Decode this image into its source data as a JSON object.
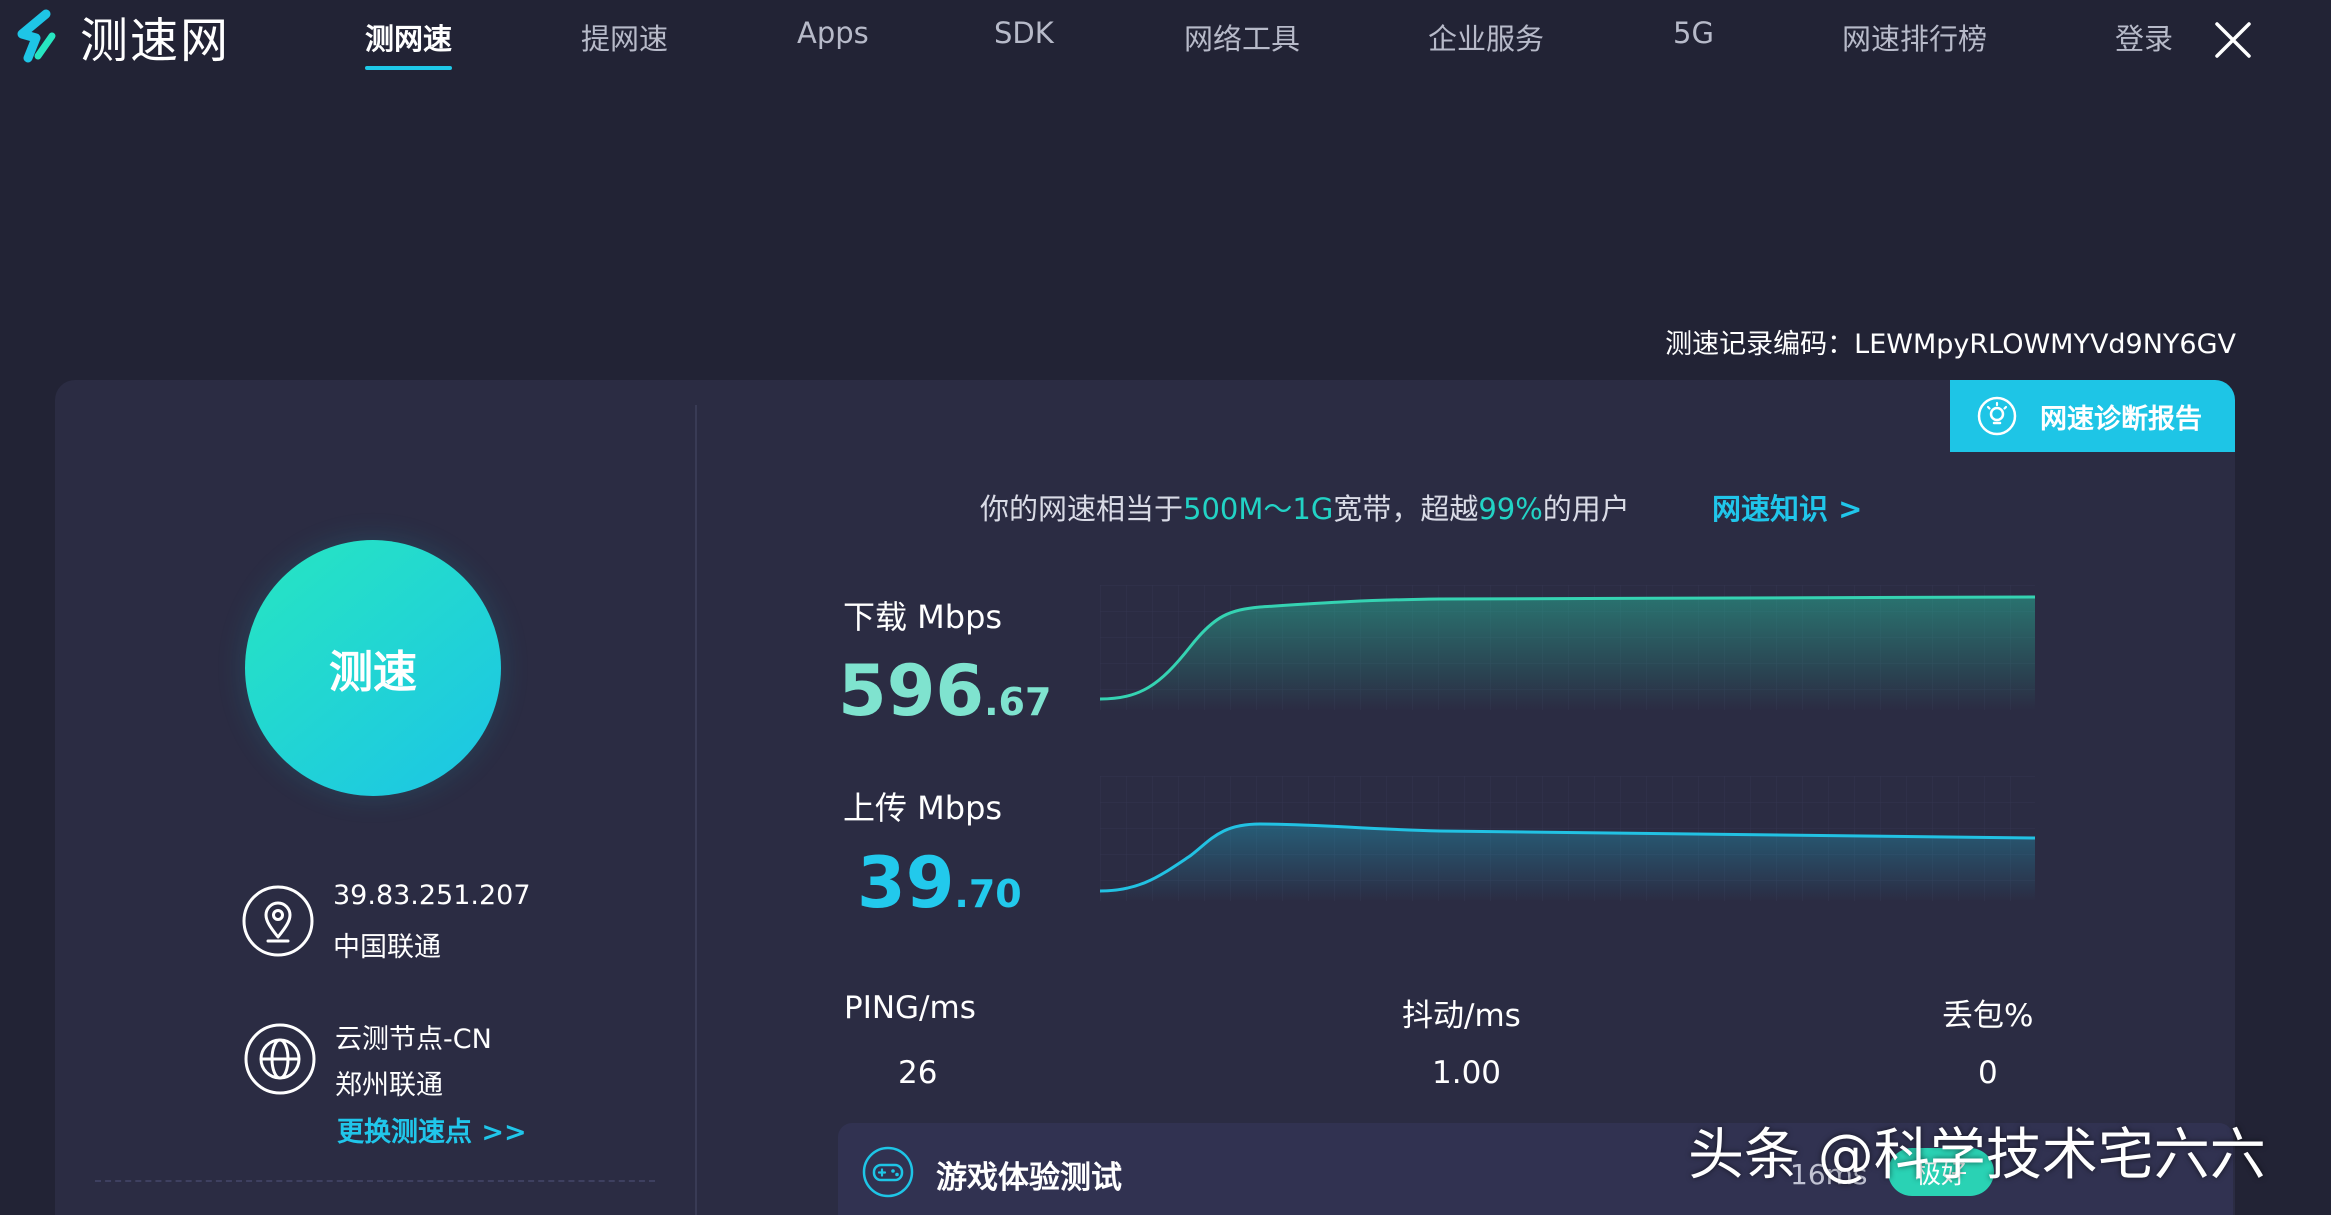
{
  "nav": {
    "logo_text": "测速网",
    "items": [
      {
        "label": "测网速",
        "active": true
      },
      {
        "label": "提网速"
      },
      {
        "label": "Apps"
      },
      {
        "label": "SDK"
      },
      {
        "label": "网络工具"
      },
      {
        "label": "企业服务"
      },
      {
        "label": "5G"
      },
      {
        "label": "网速排行榜"
      },
      {
        "label": "登录"
      }
    ]
  },
  "record": {
    "label": "测速记录编码：",
    "code": "LEWMpyRLOWMYVd9NY6GV"
  },
  "report_button": "网速诊断报告",
  "left": {
    "test_button": "测速",
    "ip": "39.83.251.207",
    "isp": "中国联通",
    "node_name": "云测节点-CN",
    "node_isp": "郑州联通",
    "change_node": "更换测速点 >>"
  },
  "summary": {
    "prefix": "你的网速相当于",
    "bandwidth": "500M～1G",
    "middle": "宽带，超越",
    "percent": "99%",
    "suffix": "的用户",
    "link": "网速知识 >"
  },
  "download": {
    "label": "下载 Mbps",
    "int": "596",
    "dec": ".67"
  },
  "upload": {
    "label": "上传 Mbps",
    "int": "39",
    "dec": ".70"
  },
  "stats": {
    "ping_label": "PING/ms",
    "ping": "26",
    "jitter_label": "抖动/ms",
    "jitter": "1.00",
    "loss_label": "丢包%",
    "loss": "0"
  },
  "game": {
    "label": "游戏体验测试",
    "time": "16ms",
    "button": "极好"
  },
  "watermark": "头条 @科学技术宅六六",
  "colors": {
    "accent": "#1ec5e6",
    "download": "#7fe3cf",
    "upload": "#22c9ec",
    "background": "#222335",
    "card": "#2b2c43"
  }
}
